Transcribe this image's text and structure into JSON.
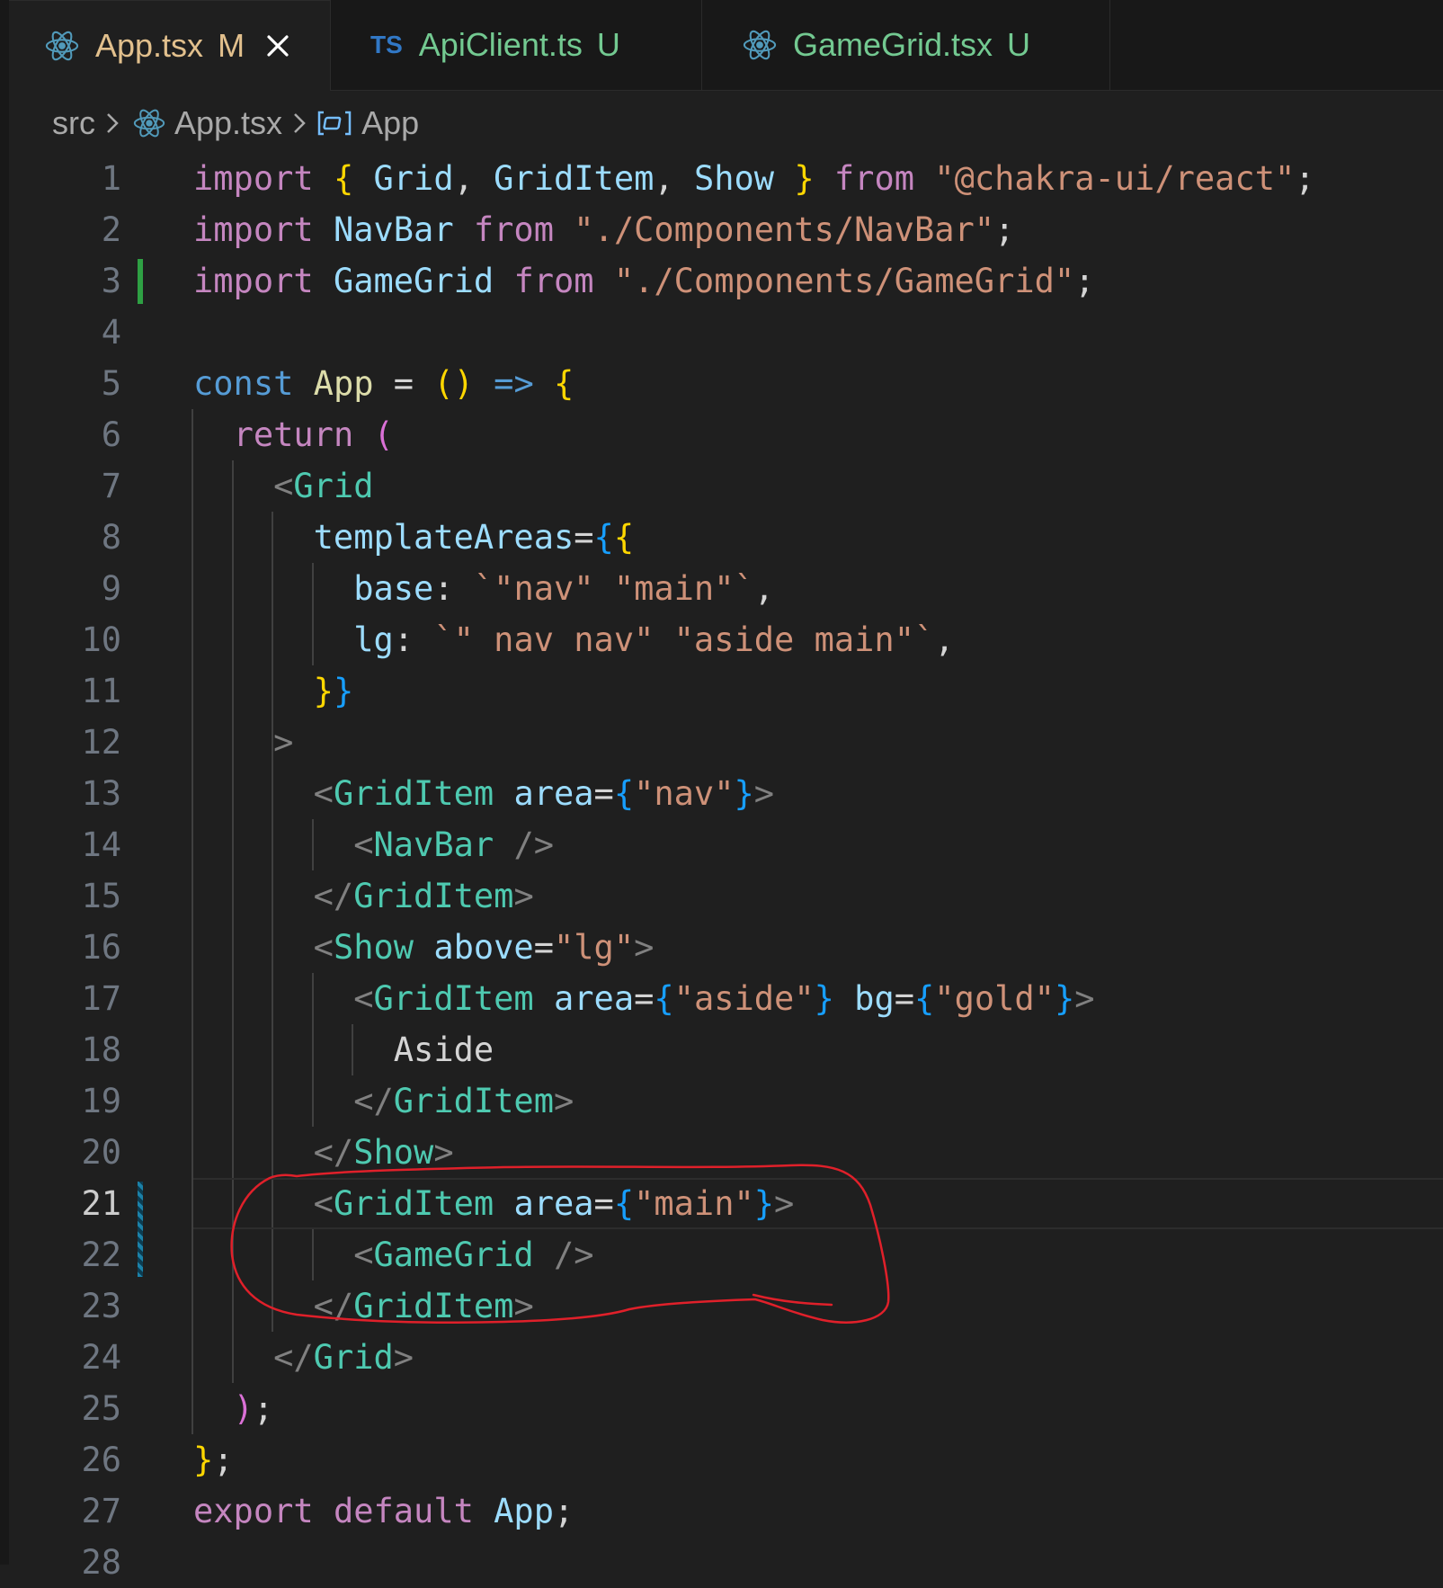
{
  "tabs": [
    {
      "label": "App.tsx",
      "status": "M",
      "icon": "react-icon",
      "active": true,
      "label_color": "#e2c08d",
      "status_color": "#e2c08d"
    },
    {
      "label": "ApiClient.ts",
      "status": "U",
      "icon": "typescript-icon",
      "icon_text": "TS",
      "active": false,
      "label_color": "#73c991",
      "status_color": "#73c991"
    },
    {
      "label": "GameGrid.tsx",
      "status": "U",
      "icon": "react-icon",
      "active": false,
      "label_color": "#73c991",
      "status_color": "#73c991"
    }
  ],
  "breadcrumb": {
    "folder": "src",
    "file": "App.tsx",
    "symbol": "App"
  },
  "editor": {
    "current_line": 21,
    "added_lines": [
      3
    ],
    "modified_lines": [
      21,
      22
    ],
    "annotation": {
      "type": "hand-drawn-circle",
      "color": "#e0202a",
      "lines": [
        21,
        22,
        23
      ]
    },
    "lines": [
      {
        "n": "1",
        "tokens": [
          [
            "kw",
            "import"
          ],
          [
            "punc",
            " "
          ],
          [
            "b1",
            "{"
          ],
          [
            "punc",
            " "
          ],
          [
            "var",
            "Grid"
          ],
          [
            "punc",
            ", "
          ],
          [
            "var",
            "GridItem"
          ],
          [
            "punc",
            ", "
          ],
          [
            "var",
            "Show"
          ],
          [
            "punc",
            " "
          ],
          [
            "b1",
            "}"
          ],
          [
            "punc",
            " "
          ],
          [
            "kw",
            "from"
          ],
          [
            "punc",
            " "
          ],
          [
            "str",
            "\"@chakra-ui/react\""
          ],
          [
            "punc",
            ";"
          ]
        ]
      },
      {
        "n": "2",
        "tokens": [
          [
            "kw",
            "import"
          ],
          [
            "punc",
            " "
          ],
          [
            "var",
            "NavBar"
          ],
          [
            "punc",
            " "
          ],
          [
            "kw",
            "from"
          ],
          [
            "punc",
            " "
          ],
          [
            "str",
            "\"./Components/NavBar\""
          ],
          [
            "punc",
            ";"
          ]
        ]
      },
      {
        "n": "3",
        "tokens": [
          [
            "kw",
            "import"
          ],
          [
            "punc",
            " "
          ],
          [
            "var",
            "GameGrid"
          ],
          [
            "punc",
            " "
          ],
          [
            "kw",
            "from"
          ],
          [
            "punc",
            " "
          ],
          [
            "str",
            "\"./Components/GameGrid\""
          ],
          [
            "punc",
            ";"
          ]
        ]
      },
      {
        "n": "4",
        "tokens": []
      },
      {
        "n": "5",
        "tokens": [
          [
            "kw-blue",
            "const"
          ],
          [
            "punc",
            " "
          ],
          [
            "fn",
            "App"
          ],
          [
            "punc",
            " = "
          ],
          [
            "b1",
            "()"
          ],
          [
            "punc",
            " "
          ],
          [
            "kw-blue",
            "=>"
          ],
          [
            "punc",
            " "
          ],
          [
            "b1",
            "{"
          ]
        ]
      },
      {
        "n": "6",
        "tokens": [
          [
            "punc",
            "  "
          ],
          [
            "kw",
            "return"
          ],
          [
            "punc",
            " "
          ],
          [
            "b2",
            "("
          ]
        ]
      },
      {
        "n": "7",
        "tokens": [
          [
            "punc",
            "    "
          ],
          [
            "tagp",
            "<"
          ],
          [
            "comp",
            "Grid"
          ]
        ]
      },
      {
        "n": "8",
        "tokens": [
          [
            "punc",
            "      "
          ],
          [
            "var",
            "templateAreas"
          ],
          [
            "punc",
            "="
          ],
          [
            "b3",
            "{"
          ],
          [
            "b1",
            "{"
          ]
        ]
      },
      {
        "n": "9",
        "tokens": [
          [
            "punc",
            "        "
          ],
          [
            "var",
            "base"
          ],
          [
            "punc",
            ": "
          ],
          [
            "str",
            "`\"nav\" \"main\"`"
          ],
          [
            "punc",
            ","
          ]
        ]
      },
      {
        "n": "10",
        "tokens": [
          [
            "punc",
            "        "
          ],
          [
            "var",
            "lg"
          ],
          [
            "punc",
            ": "
          ],
          [
            "str",
            "`\" nav nav\" \"aside main\"`"
          ],
          [
            "punc",
            ","
          ]
        ]
      },
      {
        "n": "11",
        "tokens": [
          [
            "punc",
            "      "
          ],
          [
            "b1",
            "}"
          ],
          [
            "b3",
            "}"
          ]
        ]
      },
      {
        "n": "12",
        "tokens": [
          [
            "punc",
            "    "
          ],
          [
            "tagp",
            ">"
          ]
        ]
      },
      {
        "n": "13",
        "tokens": [
          [
            "punc",
            "      "
          ],
          [
            "tagp",
            "<"
          ],
          [
            "comp",
            "GridItem"
          ],
          [
            "punc",
            " "
          ],
          [
            "var",
            "area"
          ],
          [
            "punc",
            "="
          ],
          [
            "b3",
            "{"
          ],
          [
            "str",
            "\"nav\""
          ],
          [
            "b3",
            "}"
          ],
          [
            "tagp",
            ">"
          ]
        ]
      },
      {
        "n": "14",
        "tokens": [
          [
            "punc",
            "        "
          ],
          [
            "tagp",
            "<"
          ],
          [
            "comp",
            "NavBar"
          ],
          [
            "punc",
            " "
          ],
          [
            "tagp",
            "/>"
          ]
        ]
      },
      {
        "n": "15",
        "tokens": [
          [
            "punc",
            "      "
          ],
          [
            "tagp",
            "</"
          ],
          [
            "comp",
            "GridItem"
          ],
          [
            "tagp",
            ">"
          ]
        ]
      },
      {
        "n": "16",
        "tokens": [
          [
            "punc",
            "      "
          ],
          [
            "tagp",
            "<"
          ],
          [
            "comp",
            "Show"
          ],
          [
            "punc",
            " "
          ],
          [
            "var",
            "above"
          ],
          [
            "punc",
            "="
          ],
          [
            "str",
            "\"lg\""
          ],
          [
            "tagp",
            ">"
          ]
        ]
      },
      {
        "n": "17",
        "tokens": [
          [
            "punc",
            "        "
          ],
          [
            "tagp",
            "<"
          ],
          [
            "comp",
            "GridItem"
          ],
          [
            "punc",
            " "
          ],
          [
            "var",
            "area"
          ],
          [
            "punc",
            "="
          ],
          [
            "b3",
            "{"
          ],
          [
            "str",
            "\"aside\""
          ],
          [
            "b3",
            "}"
          ],
          [
            "punc",
            " "
          ],
          [
            "var",
            "bg"
          ],
          [
            "punc",
            "="
          ],
          [
            "b3",
            "{"
          ],
          [
            "str",
            "\"gold\""
          ],
          [
            "b3",
            "}"
          ],
          [
            "tagp",
            ">"
          ]
        ]
      },
      {
        "n": "18",
        "tokens": [
          [
            "punc",
            "          "
          ],
          [
            "txt",
            "Aside"
          ]
        ]
      },
      {
        "n": "19",
        "tokens": [
          [
            "punc",
            "        "
          ],
          [
            "tagp",
            "</"
          ],
          [
            "comp",
            "GridItem"
          ],
          [
            "tagp",
            ">"
          ]
        ]
      },
      {
        "n": "20",
        "tokens": [
          [
            "punc",
            "      "
          ],
          [
            "tagp",
            "</"
          ],
          [
            "comp",
            "Show"
          ],
          [
            "tagp",
            ">"
          ]
        ]
      },
      {
        "n": "21",
        "tokens": [
          [
            "punc",
            "      "
          ],
          [
            "tagp",
            "<"
          ],
          [
            "comp",
            "GridItem"
          ],
          [
            "punc",
            " "
          ],
          [
            "var",
            "area"
          ],
          [
            "punc",
            "="
          ],
          [
            "b3",
            "{"
          ],
          [
            "str",
            "\"main\""
          ],
          [
            "b3",
            "}"
          ],
          [
            "tagp",
            ">"
          ]
        ]
      },
      {
        "n": "22",
        "tokens": [
          [
            "punc",
            "        "
          ],
          [
            "tagp",
            "<"
          ],
          [
            "comp",
            "GameGrid"
          ],
          [
            "punc",
            " "
          ],
          [
            "tagp",
            "/>"
          ]
        ]
      },
      {
        "n": "23",
        "tokens": [
          [
            "punc",
            "      "
          ],
          [
            "tagp",
            "</"
          ],
          [
            "comp",
            "GridItem"
          ],
          [
            "tagp",
            ">"
          ]
        ]
      },
      {
        "n": "24",
        "tokens": [
          [
            "punc",
            "    "
          ],
          [
            "tagp",
            "</"
          ],
          [
            "comp",
            "Grid"
          ],
          [
            "tagp",
            ">"
          ]
        ]
      },
      {
        "n": "25",
        "tokens": [
          [
            "punc",
            "  "
          ],
          [
            "b2",
            ")"
          ],
          [
            "punc",
            ";"
          ]
        ]
      },
      {
        "n": "26",
        "tokens": [
          [
            "b1",
            "}"
          ],
          [
            "punc",
            ";"
          ]
        ]
      },
      {
        "n": "27",
        "tokens": [
          [
            "kw",
            "export"
          ],
          [
            "punc",
            " "
          ],
          [
            "kw",
            "default"
          ],
          [
            "punc",
            " "
          ],
          [
            "var",
            "App"
          ],
          [
            "punc",
            ";"
          ]
        ]
      },
      {
        "n": "28",
        "tokens": []
      }
    ]
  }
}
